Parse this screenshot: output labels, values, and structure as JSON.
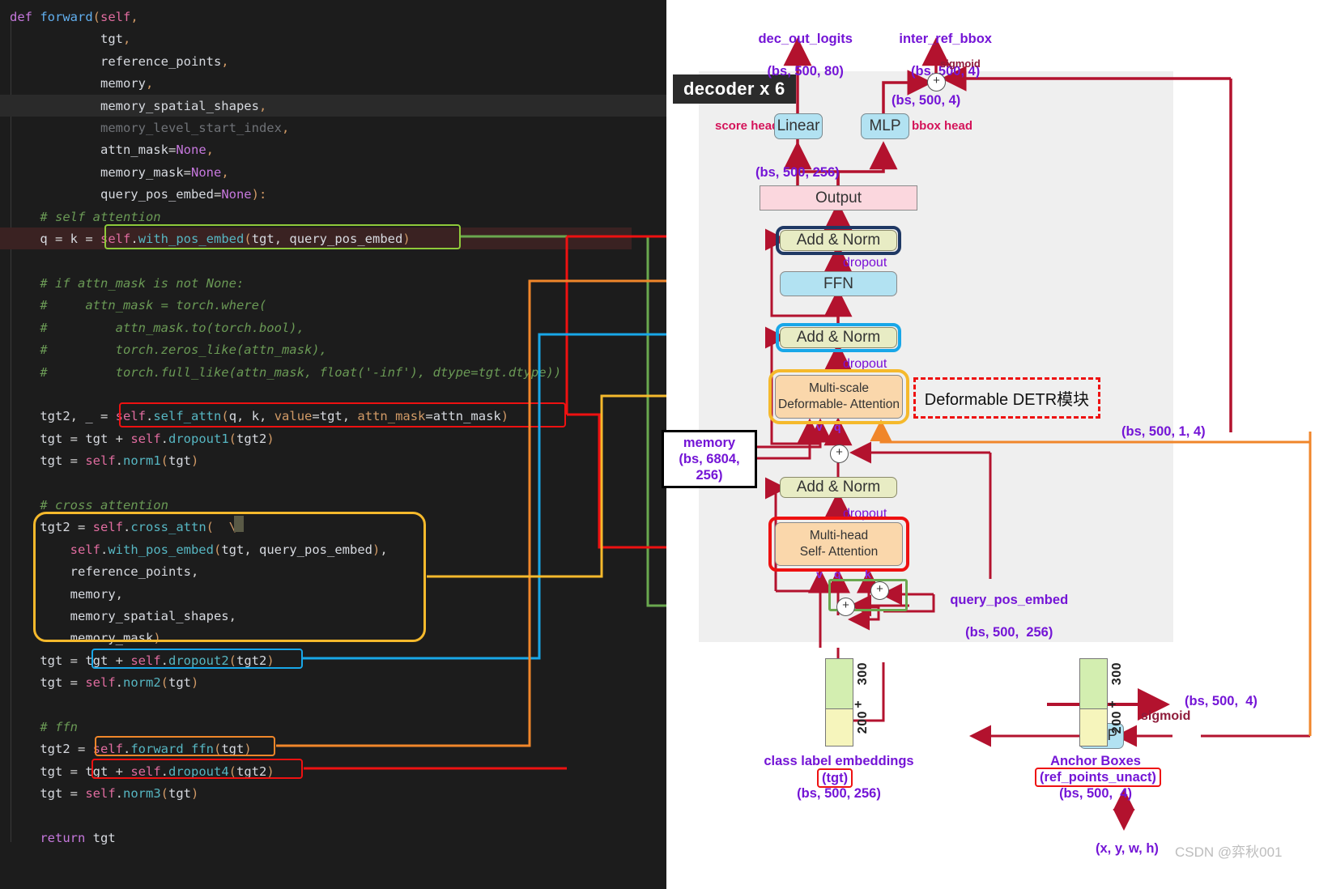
{
  "code": {
    "lines": [
      "def forward(self,",
      "            tgt,",
      "            reference_points,",
      "            memory,",
      "            memory_spatial_shapes,",
      "            memory_level_start_index,",
      "            attn_mask=None,",
      "            memory_mask=None,",
      "            query_pos_embed=None):",
      "    # self attention",
      "    q = k = self.with_pos_embed(tgt, query_pos_embed)",
      "",
      "    # if attn_mask is not None:",
      "    #     attn_mask = torch.where(",
      "    #         attn_mask.to(torch.bool),",
      "    #         torch.zeros_like(attn_mask),",
      "    #         torch.full_like(attn_mask, float('-inf'), dtype=tgt.dtype))",
      "",
      "    tgt2, _ = self.self_attn(q, k, value=tgt, attn_mask=attn_mask)",
      "    tgt = tgt + self.dropout1(tgt2)",
      "    tgt = self.norm1(tgt)",
      "",
      "    # cross attention",
      "    tgt2 = self.cross_attn(\\",
      "        self.with_pos_embed(tgt, query_pos_embed),",
      "        reference_points,",
      "        memory,",
      "        memory_spatial_shapes,",
      "        memory_mask)",
      "    tgt = tgt + self.dropout2(tgt2)",
      "    tgt = self.norm2(tgt)",
      "",
      "    # ffn",
      "    tgt2 = self.forward_ffn(tgt)",
      "    tgt = tgt + self.dropout4(tgt2)",
      "    tgt = self.norm3(tgt)",
      "",
      "    return tgt"
    ],
    "highlights": [
      {
        "name": "with-pos-embed-green",
        "color": "#8fc93a",
        "label": "self.with_pos_embed(tgt, query_pos_embed)"
      },
      {
        "name": "self-attn-red",
        "color": "#ee1111",
        "label": "self.self_attn(q, k, value=tgt, attn_mask=attn_mask)"
      },
      {
        "name": "cross-attn-yellow",
        "color": "#f5b92c",
        "label": "tgt2 = self.cross_attn(...)"
      },
      {
        "name": "dropout2-blue",
        "color": "#18a7e8",
        "label": "tgt + self.dropout2(tgt2)"
      },
      {
        "name": "forward-ffn-orange",
        "color": "#f0862a",
        "label": "self.forward_ffn(tgt)"
      },
      {
        "name": "dropout4-red",
        "color": "#ee1111",
        "label": "tgt + self.dropout4(tgt2)"
      }
    ]
  },
  "diagram": {
    "decoder_title": "decoder x 6",
    "outputs": {
      "logits_name": "dec_out_logits",
      "logits_shape": "(bs, 500, 80)",
      "bbox_name": "inter_ref_bbox",
      "bbox_shape": "(bs, 500, 4)",
      "sigmoid_label": "sigmoid",
      "residual_shape": "(bs, 500, 4)"
    },
    "heads": {
      "score_head_label": "score head",
      "score_head_node": "Linear",
      "bbox_head_node": "MLP",
      "bbox_head_label": "bbox head",
      "hidden_shape": "(bs, 500, 256)"
    },
    "blocks": {
      "output": "Output",
      "add_norm_top": "Add & Norm",
      "ffn": "FFN",
      "add_norm_mid": "Add & Norm",
      "deformable_attn": "Multi-scale\nDeformable- Attention",
      "add_norm_bottom": "Add & Norm",
      "self_attn": "Multi-head\nSelf- Attention",
      "mlp_right": "MLP"
    },
    "dropout_labels": [
      "dropout",
      "dropout",
      "dropout"
    ],
    "memory": {
      "name": "memory",
      "shape": "(bs, 6804, 256)"
    },
    "deformable_note": "Deformable DETR模块",
    "ref_points_shape": "(bs, 500, 1, 4)",
    "query_pos_embed": {
      "name": "query_pos_embed",
      "shape": "(bs, 500,  256)"
    },
    "qkv_labels": [
      "v",
      "q",
      "k"
    ],
    "class_embeddings": {
      "title": "class label embeddings",
      "alias": "(tgt)",
      "shape": "(bs, 500, 256)",
      "top_count": "300",
      "plus": "+",
      "bottom_count": "200"
    },
    "anchor_boxes": {
      "title": "Anchor Boxes",
      "alias": "(ref_points_unact)",
      "shape": "(bs, 500,  4)",
      "top_count": "300",
      "plus": "+",
      "bottom_count": "200",
      "sigmoid_label": "sigmoid",
      "sigmoid_shape": "(bs, 500,  4)",
      "coords": "(x, y, w, h)"
    },
    "watermark": "CSDN @弈秋001"
  },
  "colors": {
    "wire_red": "#b3122e",
    "bright_red": "#ee1111",
    "green": "#6aa84f",
    "blue": "#18a7e8",
    "orange": "#f0862a",
    "yellow": "#f5b92c",
    "purple_text": "#7415d6",
    "decoder_bg": "#efefef"
  }
}
